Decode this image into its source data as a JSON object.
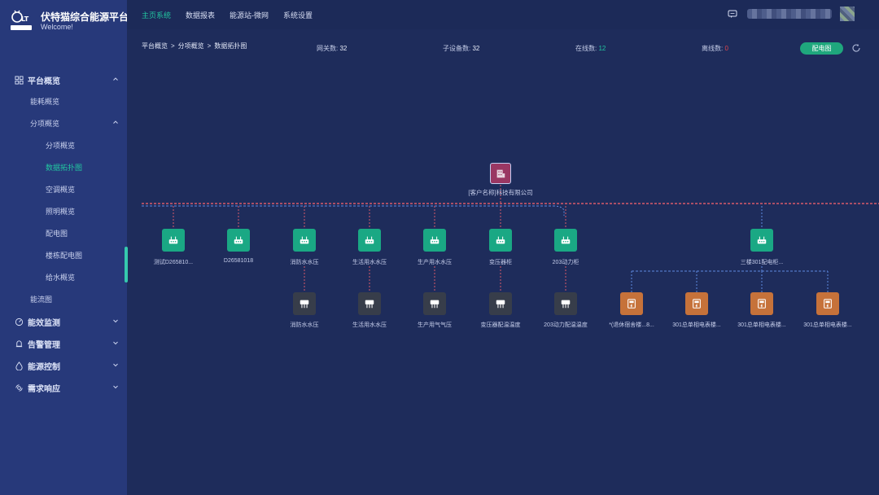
{
  "brand": {
    "title": "伏特猫综合能源平台",
    "subtitle": "Welcome!"
  },
  "header": {
    "tabs": [
      "主页系统",
      "数据报表",
      "能源站-微网",
      "系统设置"
    ],
    "active_tab": 0
  },
  "sidebar": {
    "items": [
      {
        "label": "平台概览",
        "level": 0,
        "icon": "grid-icon",
        "chevron": "up"
      },
      {
        "label": "能耗概览",
        "level": 1
      },
      {
        "label": "分项概览",
        "level": 1,
        "chevron": "up"
      },
      {
        "label": "分项概览",
        "level": 2
      },
      {
        "label": "数据拓扑图",
        "level": 2,
        "active": true
      },
      {
        "label": "空调概览",
        "level": 2
      },
      {
        "label": "照明概览",
        "level": 2
      },
      {
        "label": "配电图",
        "level": 2
      },
      {
        "label": "楼栋配电图",
        "level": 2
      },
      {
        "label": "给水概览",
        "level": 2
      },
      {
        "label": "能流图",
        "level": 1
      },
      {
        "label": "能效监测",
        "level": 0,
        "icon": "gauge-icon",
        "chevron": "down"
      },
      {
        "label": "告警管理",
        "level": 0,
        "icon": "alarm-icon",
        "chevron": "down"
      },
      {
        "label": "能源控制",
        "level": 0,
        "icon": "drop-icon",
        "chevron": "down"
      },
      {
        "label": "需求响应",
        "level": 0,
        "icon": "response-icon",
        "chevron": "down"
      }
    ]
  },
  "breadcrumb": [
    "平台概览",
    "分项概览",
    "数据拓扑图"
  ],
  "stats": {
    "gateways_label": "网关数:",
    "gateways_value": "32",
    "subdevices_label": "子设备数:",
    "subdevices_value": "32",
    "online_label": "在线数:",
    "online_value": "12",
    "offline_label": "离线数:",
    "offline_value": "0"
  },
  "buttons": {
    "distribution": "配电图"
  },
  "colors": {
    "accent": "#22c6a0",
    "gateway": "#1aa884",
    "root": "#9a3763",
    "device": "#373d4a",
    "meter": "#c6723a",
    "line_red": "#d85a6a",
    "line_blue": "#5f8ae0"
  },
  "topology": {
    "root": {
      "label": "[客户名称]科技有限公司",
      "icon": "building-icon"
    },
    "gateways": [
      {
        "label": "测试D265810...",
        "icon": "router-icon"
      },
      {
        "label": "D26581018",
        "icon": "router-icon"
      },
      {
        "label": "消防水水压",
        "icon": "router-icon"
      },
      {
        "label": "生活用水水压",
        "icon": "router-icon"
      },
      {
        "label": "生产用水水压",
        "icon": "router-icon"
      },
      {
        "label": "变压器柜",
        "icon": "router-icon"
      },
      {
        "label": "203动力柜",
        "icon": "router-icon"
      },
      {
        "label": "三楼301配电柜...",
        "icon": "router-icon"
      }
    ],
    "devices": [
      {
        "label": "消防水水压",
        "icon": "sensor-icon"
      },
      {
        "label": "生活用水水压",
        "icon": "sensor-icon"
      },
      {
        "label": "生产用气气压",
        "icon": "sensor-icon"
      },
      {
        "label": "变压器配温温度",
        "icon": "sensor-icon"
      },
      {
        "label": "203动力配温温度",
        "icon": "sensor-icon"
      }
    ],
    "meters": [
      {
        "label": "*(退休宿舍楼...8...",
        "icon": "meter-icon"
      },
      {
        "label": "301总单相电表楼...",
        "icon": "meter-icon"
      },
      {
        "label": "301总单相电表楼...",
        "icon": "meter-icon"
      },
      {
        "label": "301总单相电表楼...",
        "icon": "meter-icon"
      }
    ]
  }
}
